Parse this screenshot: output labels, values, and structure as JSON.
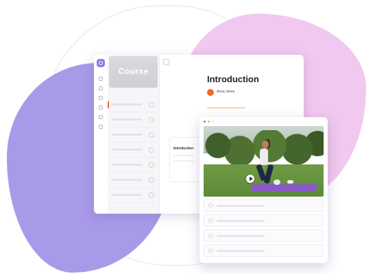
{
  "course": {
    "cover_title": "Course",
    "lessons": [
      {
        "active": true
      },
      {
        "active": false
      },
      {
        "active": false
      },
      {
        "active": false
      },
      {
        "active": false
      },
      {
        "active": false
      },
      {
        "active": false
      }
    ]
  },
  "main": {
    "title": "Introduction",
    "author_name": "Anna Jones"
  },
  "inner_card": {
    "label": "Introduction"
  },
  "video": {
    "window_dots": [
      "#ef6a2d",
      "#f5b53d",
      "#e8e8ee"
    ],
    "playlist_count": 4
  },
  "colors": {
    "accent": "#ef6a2d",
    "brand": "#8b7be3",
    "blob_pink": "#f1c8ef",
    "blob_purple": "#a99ae9"
  }
}
